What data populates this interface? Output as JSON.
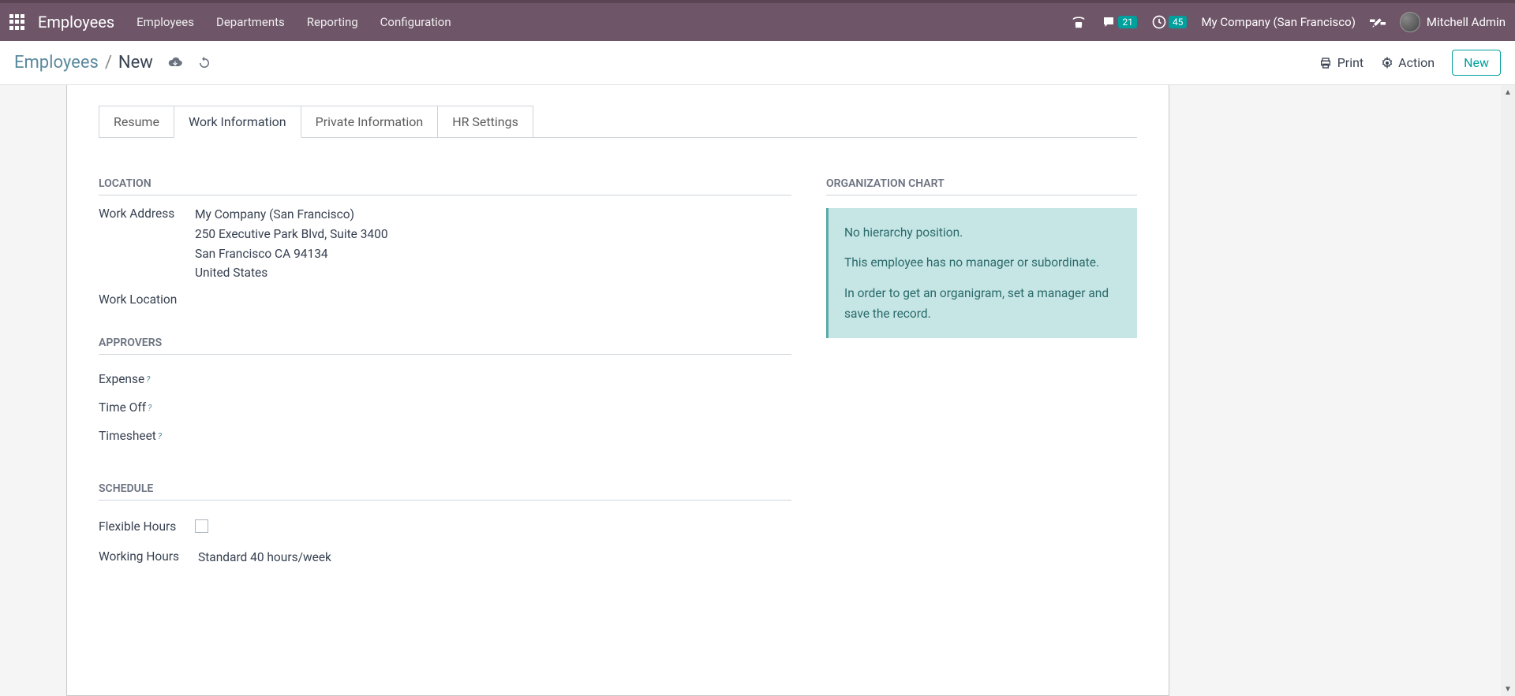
{
  "navbar": {
    "brand": "Employees",
    "links": [
      "Employees",
      "Departments",
      "Reporting",
      "Configuration"
    ],
    "msg_badge": "21",
    "clock_badge": "45",
    "company": "My Company (San Francisco)",
    "user": "Mitchell Admin"
  },
  "control_panel": {
    "breadcrumb_root": "Employees",
    "breadcrumb_sep": "/",
    "breadcrumb_leaf": "New",
    "print": "Print",
    "action": "Action",
    "new": "New"
  },
  "tabs": [
    "Resume",
    "Work Information",
    "Private Information",
    "HR Settings"
  ],
  "sections": {
    "location": {
      "title": "LOCATION",
      "work_address_label": "Work Address",
      "addr_line1": "My Company (San Francisco)",
      "addr_line2": "250 Executive Park Blvd, Suite 3400",
      "addr_line3": "San Francisco CA 94134",
      "addr_line4": "United States",
      "work_location_label": "Work Location"
    },
    "approvers": {
      "title": "APPROVERS",
      "expense": "Expense",
      "timeoff": "Time Off",
      "timesheet": "Timesheet"
    },
    "schedule": {
      "title": "SCHEDULE",
      "flexible_label": "Flexible Hours",
      "working_hours_label": "Working Hours",
      "working_hours_value": "Standard 40 hours/week"
    },
    "org": {
      "title": "ORGANIZATION CHART",
      "p1": "No hierarchy position.",
      "p2": "This employee has no manager or subordinate.",
      "p3": "In order to get an organigram, set a manager and save the record."
    }
  }
}
